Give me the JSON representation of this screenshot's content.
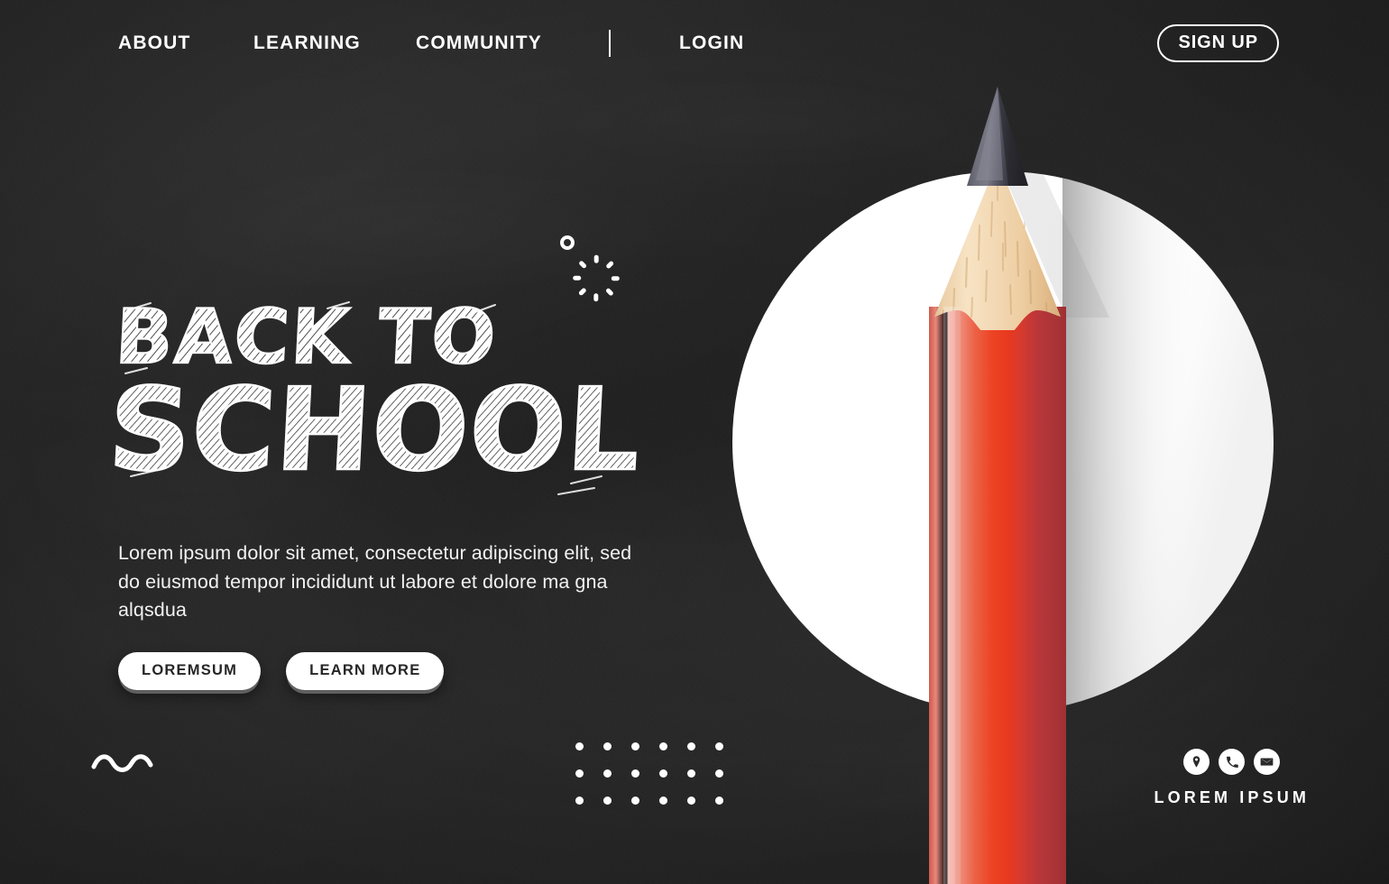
{
  "theme": {
    "board_dark": "#2b2b2b",
    "chalk_white": "#ffffff",
    "pencil_red": "#e8412a",
    "pencil_red_dark": "#a8322f",
    "pencil_red_light": "#f2a095",
    "wood_tan": "#f3d7b0",
    "graphite_gray": "#5b5b66",
    "text_light": "#f2f2f2"
  },
  "nav": {
    "links": [
      {
        "label": "ABOUT",
        "name": "nav-link-about"
      },
      {
        "label": "LEARNING",
        "name": "nav-link-learning"
      },
      {
        "label": "COMMUNITY",
        "name": "nav-link-community"
      },
      {
        "label": "LOGIN",
        "name": "nav-link-login"
      }
    ],
    "divider": "|",
    "signup_label": "SIGN UP"
  },
  "hero": {
    "headline_line1": "BACK TO",
    "headline_line2": "SCHOOL",
    "headline_full": "BACK TO SCHOOL",
    "description": "Lorem ipsum dolor sit amet, consectetur adipiscing elit, sed do eiusmod tempor incididunt ut labore et dolore ma gna alqsdua",
    "buttons": [
      {
        "label": "LOREMSUM",
        "name": "cta-loremsum-button"
      },
      {
        "label": "LEARN MORE",
        "name": "cta-learn-more-button"
      }
    ]
  },
  "contact": {
    "label": "LOREM IPSUM",
    "icons": [
      {
        "name": "location-pin-icon",
        "title": "location"
      },
      {
        "name": "phone-icon",
        "title": "phone"
      },
      {
        "name": "envelope-icon",
        "title": "email"
      }
    ]
  },
  "decorations": {
    "ring": "small-circle-outline",
    "burst": "sunburst-spinner",
    "squiggle": "wave-squiggle",
    "dot_grid": {
      "columns": 6,
      "rows": 3
    }
  },
  "artwork": {
    "circle": "white-circle-backdrop",
    "pencil": "red-sharpened-pencil"
  }
}
